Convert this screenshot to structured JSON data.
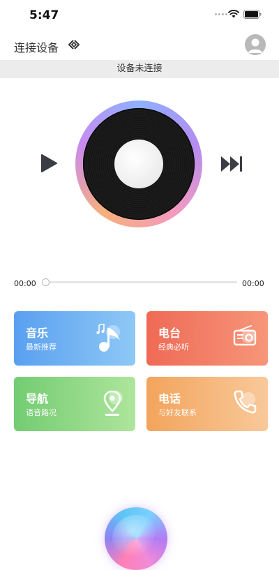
{
  "status_bar": {
    "time": "5:47"
  },
  "header": {
    "title": "连接设备"
  },
  "banner": {
    "text": "设备未连接"
  },
  "player": {
    "current_time": "00:00",
    "total_time": "00:00",
    "progress": 0
  },
  "cards": [
    {
      "title": "音乐",
      "subtitle": "最新推荐",
      "icon": "music-note-icon",
      "color": "#5aa0f0"
    },
    {
      "title": "电台",
      "subtitle": "经典必听",
      "icon": "radio-icon",
      "color": "#ef6a55"
    },
    {
      "title": "导航",
      "subtitle": "语音路况",
      "icon": "map-pin-icon",
      "color": "#73cc72"
    },
    {
      "title": "电话",
      "subtitle": "与好友联系",
      "icon": "phone-icon",
      "color": "#f3a45c"
    }
  ]
}
